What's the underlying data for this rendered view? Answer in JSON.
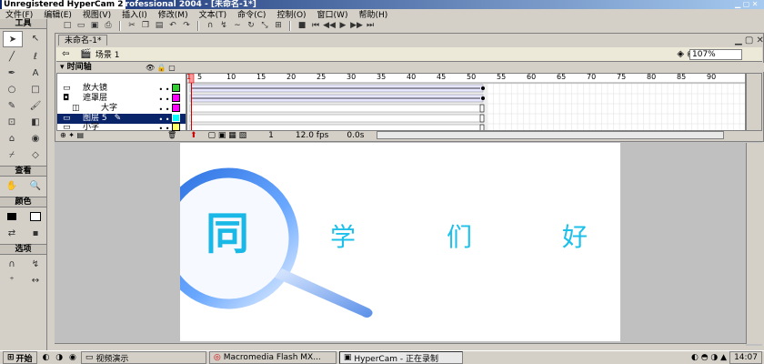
{
  "window": {
    "watermark": "Unregistered HyperCam 2",
    "title": "rofessional 2004 - [未命名-1*]"
  },
  "menu": [
    "文件(F)",
    "编辑(E)",
    "视图(V)",
    "插入(I)",
    "修改(M)",
    "文本(T)",
    "命令(C)",
    "控制(O)",
    "窗口(W)",
    "帮助(H)"
  ],
  "toolbox": {
    "header": "工具",
    "view_label": "查看",
    "colors_label": "颜色",
    "options_label": "选项"
  },
  "document": {
    "tab_label": "未命名-1*",
    "scene_label": "场景 1",
    "zoom": "107%"
  },
  "timeline": {
    "header": "时间轴",
    "layers": [
      "放大镜",
      "遮罩层",
      "大字",
      "图层 5",
      "小字"
    ],
    "ruler": [
      "1",
      "5",
      "10",
      "15",
      "20",
      "25",
      "30",
      "35",
      "40",
      "45",
      "50",
      "55",
      "60",
      "65",
      "70",
      "75",
      "80",
      "85",
      "90"
    ],
    "current_frame": "1",
    "fps": "12.0 fps",
    "time": "0.0s"
  },
  "stage": {
    "big_char": "同",
    "chars": [
      "学",
      "们",
      "好"
    ]
  },
  "taskbar": {
    "start": "开始",
    "tasks": [
      "视频演示",
      "Macromedia Flash MX...",
      "HyperCam - 正在录制"
    ],
    "clock": "14:07"
  }
}
